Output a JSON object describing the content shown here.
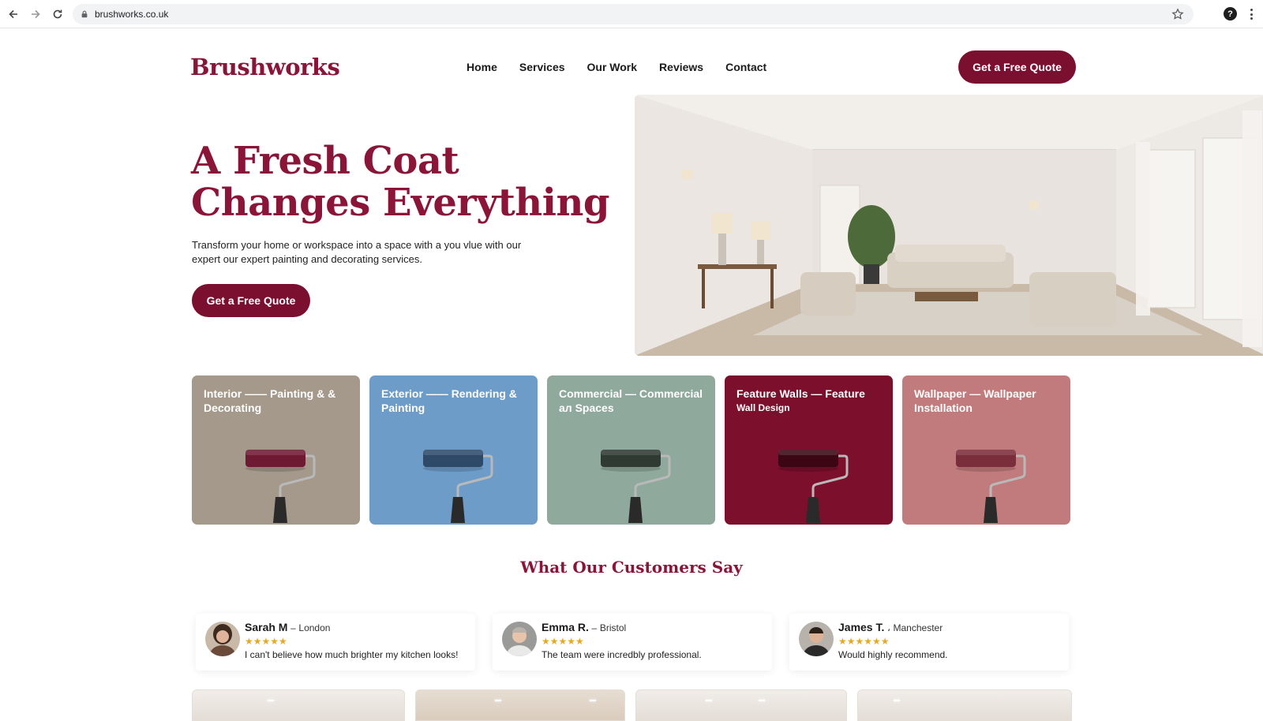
{
  "browser": {
    "url": "brushworks.co.uk"
  },
  "header": {
    "logo": "Brushworks",
    "nav": [
      "Home",
      "Services",
      "Our Work",
      "Reviews",
      "Contact"
    ],
    "cta": "Get a Free Quote"
  },
  "hero": {
    "title_line1": "A Fresh Coat",
    "title_line2": "Changes Everything",
    "text": "Transform your home or workspace into a space with a you vlue with our expert our expert painting and decorating services.",
    "cta": "Get a Free Quote"
  },
  "services": [
    {
      "title": "Interior —— Painting & & Decorating",
      "subtitle": "",
      "bg": "#a4998a",
      "roller": "#6e1a33"
    },
    {
      "title": "Exterior —— Rendering & Painting",
      "subtitle": "",
      "bg": "#6e9cc8",
      "roller": "#2e4a69"
    },
    {
      "title": "Commercial — Commercial aл Spaces",
      "subtitle": "",
      "bg": "#8fa99c",
      "roller": "#2f3a33"
    },
    {
      "title": "Feature Walls — Feature",
      "subtitle": "Wall Design",
      "bg": "#7b0f2c",
      "roller": "#3d0614"
    },
    {
      "title": "Wallpaper — Wallpaper Installation",
      "subtitle": "",
      "bg": "#c27b7c",
      "roller": "#7a2e3c"
    }
  ],
  "testimonials": {
    "title": "What Our Customers Say",
    "items": [
      {
        "name": "Sarah M",
        "sep": "–",
        "city": "London",
        "stars": "★★★★★",
        "quote": "I can't believe how much brighter my kitchen looks!"
      },
      {
        "name": "Emma R.",
        "sep": "–",
        "city": "Bristol",
        "stars": "★★★★★",
        "quote": "The team were incredbly professional."
      },
      {
        "name": "James T.",
        "sep": "،",
        "city": "Manchester",
        "stars": "★★★★★★",
        "quote": "Would highly recommend."
      }
    ]
  },
  "colors": {
    "brand": "#7b0f30",
    "brand_text": "#8a1538",
    "star": "#e5a92a"
  }
}
